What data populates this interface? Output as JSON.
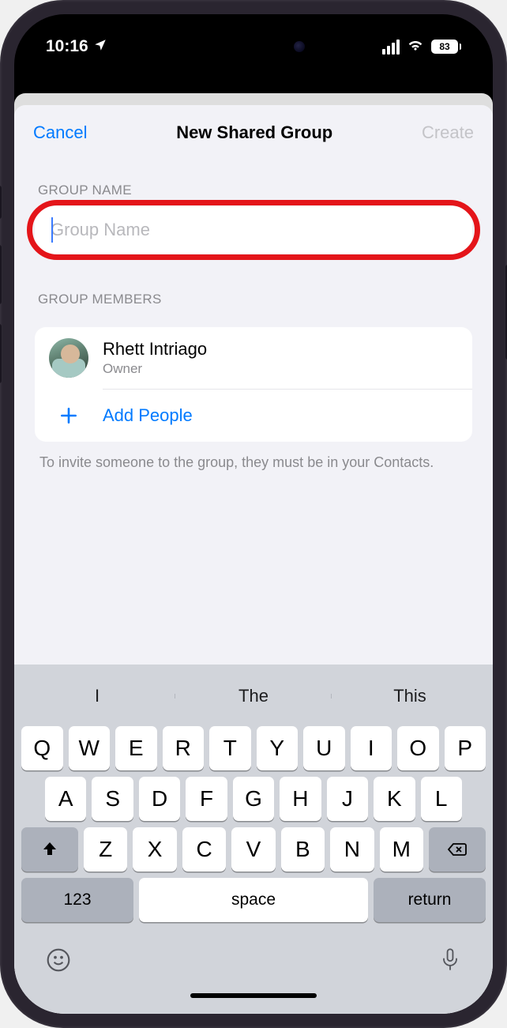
{
  "status": {
    "time": "10:16",
    "battery": "83"
  },
  "header": {
    "cancel_label": "Cancel",
    "title": "New Shared Group",
    "create_label": "Create"
  },
  "group_name": {
    "section_label": "GROUP NAME",
    "placeholder": "Group Name",
    "value": ""
  },
  "members": {
    "section_label": "GROUP MEMBERS",
    "owner": {
      "name": "Rhett Intriago",
      "role": "Owner"
    },
    "add_people_label": "Add People",
    "footnote": "To invite someone to the group, they must be in your Contacts."
  },
  "keyboard": {
    "suggestions": [
      "I",
      "The",
      "This"
    ],
    "row1": [
      "Q",
      "W",
      "E",
      "R",
      "T",
      "Y",
      "U",
      "I",
      "O",
      "P"
    ],
    "row2": [
      "A",
      "S",
      "D",
      "F",
      "G",
      "H",
      "J",
      "K",
      "L"
    ],
    "row3": [
      "Z",
      "X",
      "C",
      "V",
      "B",
      "N",
      "M"
    ],
    "numeric_label": "123",
    "space_label": "space",
    "return_label": "return"
  }
}
